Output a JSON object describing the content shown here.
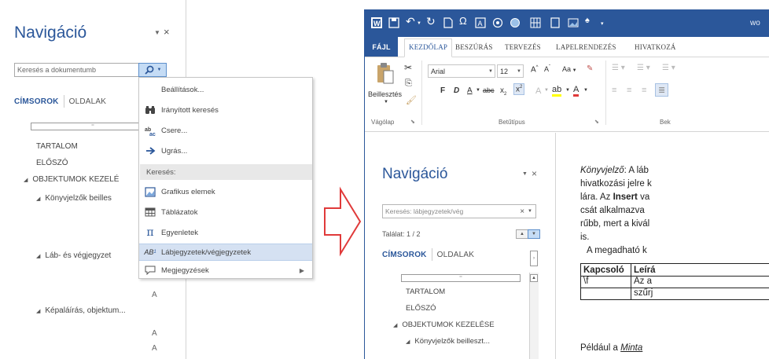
{
  "left_panel": {
    "title": "Navigáció",
    "search_placeholder": "Keresés a dokumentumb",
    "tabs": [
      {
        "label": "CÍMSOROK",
        "active": true
      },
      {
        "label": "OLDALAK",
        "active": false
      }
    ],
    "headings": [
      {
        "label": "TARTALOM",
        "level": 1,
        "expandable": false
      },
      {
        "label": "ELŐSZÓ",
        "level": 1,
        "expandable": false
      },
      {
        "label": "OBJEKTUMOK KEZELÉ",
        "level": 1,
        "expandable": true
      },
      {
        "label": "Könyvjelzők beilles",
        "level": 2,
        "expandable": true
      },
      {
        "label": "Láb- és végjegyzet",
        "level": 2,
        "expandable": true
      },
      {
        "label": "Képaláírás, objektum...",
        "level": 2,
        "expandable": true
      }
    ],
    "a_markers": [
      "A",
      "A",
      "A",
      "A"
    ],
    "collapse_symbol": "⁼"
  },
  "dropdown_menu": {
    "items_top": [
      {
        "label": "Beállítások...",
        "icon": "none"
      },
      {
        "label": "Irányított keresés",
        "icon": "binoculars-icon"
      },
      {
        "label": "Csere...",
        "icon": "replace-icon"
      },
      {
        "label": "Ugrás...",
        "icon": "arrow-right-icon"
      }
    ],
    "section_header": "Keresés:",
    "items_bottom": [
      {
        "label": "Grafikus elemek",
        "icon": "graphics-icon"
      },
      {
        "label": "Táblázatok",
        "icon": "table-icon"
      },
      {
        "label": "Egyenletek",
        "icon": "pi-icon"
      },
      {
        "label": "Lábjegyzetek/végjegyzetek",
        "icon": "footnote-icon",
        "highlighted": true
      },
      {
        "label": "Megjegyzések",
        "icon": "comment-icon",
        "submenu": true
      }
    ]
  },
  "word_window": {
    "title_fragment": "wo",
    "ribbon_tabs": [
      "FÁJL",
      "KEZDŐLAP",
      "BESZÚRÁS",
      "TERVEZÉS",
      "LAPELRENDEZÉS",
      "HIVATKOZÁ"
    ],
    "active_tab": "KEZDŐLAP",
    "clipboard": {
      "paste_label": "Beillesztés",
      "group_label": "Vágólap"
    },
    "font": {
      "name": "Arial",
      "size": "12",
      "group_label": "Betűtípus",
      "format_buttons": [
        "F",
        "D",
        "A"
      ],
      "case_button": "Aa"
    },
    "paragraph_group_label": "Bek",
    "nav_pane": {
      "title": "Navigáció",
      "search_value": "Keresés: lábjegyzetek/vég",
      "result_count": "Találat: 1 / 2",
      "tabs": [
        {
          "label": "CÍMSOROK",
          "active": true
        },
        {
          "label": "OLDALAK",
          "active": false
        }
      ],
      "headings": [
        {
          "label": "TARTALOM",
          "level": 1
        },
        {
          "label": "ELŐSZÓ",
          "level": 1
        },
        {
          "label": "OBJEKTUMOK KEZELÉSE",
          "level": 1
        },
        {
          "label": "Könyvjelzők beilleszt...",
          "level": 2
        }
      ]
    },
    "document": {
      "line1_italic": "Könyvjelző",
      "line1_rest": ": A láb",
      "line2": "hivatkozási jelre k",
      "line3_pre": "lára. Az ",
      "line3_bold": "Insert",
      "line3_post": " va",
      "line4": "csát alkalmazva",
      "line5": "rűbb, mert a kivál",
      "line6": "is.",
      "line7": "A megadható k",
      "table_headers": [
        "Kapcsoló",
        "Leírá"
      ],
      "table_row": [
        "\\f",
        "Az a"
      ],
      "table_row2": [
        "",
        "szűrj"
      ],
      "line8_pre": "Például a ",
      "line8_italic": "Minta"
    }
  },
  "colors": {
    "word_blue": "#2b579a",
    "highlight": "#d5e1f2",
    "arrow_red": "#e03a3a"
  }
}
